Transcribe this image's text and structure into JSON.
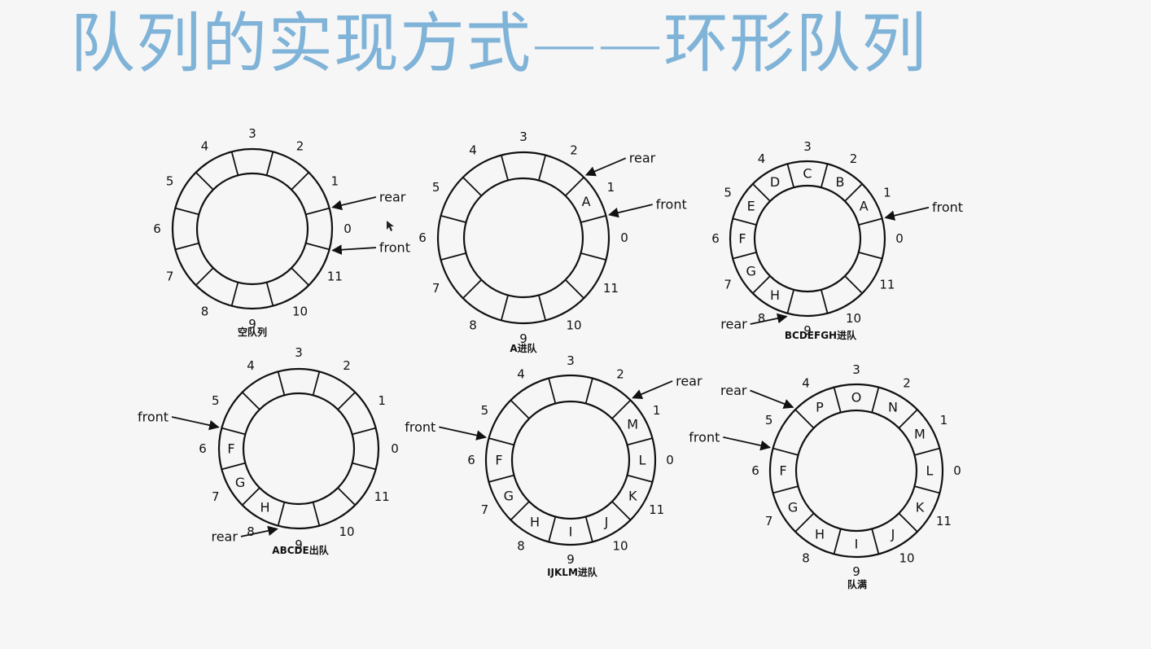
{
  "title": "队列的实现方式——环形队列",
  "index_labels": [
    "0",
    "1",
    "2",
    "3",
    "4",
    "5",
    "6",
    "7",
    "8",
    "9",
    "10",
    "11"
  ],
  "rings": [
    {
      "id": "empty",
      "caption": "空队列",
      "cells": {},
      "pointers": [
        {
          "label": "rear",
          "slot": 0.5
        },
        {
          "label": "front",
          "slot": -0.5
        }
      ]
    },
    {
      "id": "enqueue-a",
      "caption": "A进队",
      "cells": {
        "1": "A"
      },
      "pointers": [
        {
          "label": "rear",
          "slot": 1.5
        },
        {
          "label": "front",
          "slot": 0.5
        }
      ]
    },
    {
      "id": "enqueue-bcdefgh",
      "caption": "BCDEFGH进队",
      "cells": {
        "1": "A",
        "2": "B",
        "3": "C",
        "4": "D",
        "5": "E",
        "6": "F",
        "7": "G",
        "8": "H"
      },
      "pointers": [
        {
          "label": "front",
          "slot": 0.5
        },
        {
          "label": "rear",
          "slot": 8.5
        }
      ]
    },
    {
      "id": "dequeue-abcde",
      "caption": "ABCDE出队",
      "cells": {
        "6": "F",
        "7": "G",
        "8": "H"
      },
      "pointers": [
        {
          "label": "front",
          "slot": 5.5
        },
        {
          "label": "rear",
          "slot": 8.5
        }
      ]
    },
    {
      "id": "enqueue-ijklm",
      "caption": "IJKLM进队",
      "cells": {
        "6": "F",
        "7": "G",
        "8": "H",
        "9": "I",
        "10": "J",
        "11": "K",
        "0": "L",
        "1": "M"
      },
      "pointers": [
        {
          "label": "rear",
          "slot": 1.5
        },
        {
          "label": "front",
          "slot": 5.5
        }
      ]
    },
    {
      "id": "full",
      "caption": "队满",
      "cells": {
        "6": "F",
        "7": "G",
        "8": "H",
        "9": "I",
        "10": "J",
        "11": "K",
        "0": "L",
        "1": "M",
        "2": "N",
        "3": "O",
        "4": "P"
      },
      "pointers": [
        {
          "label": "rear",
          "slot": 4.5
        },
        {
          "label": "front",
          "slot": 5.5
        }
      ]
    }
  ]
}
